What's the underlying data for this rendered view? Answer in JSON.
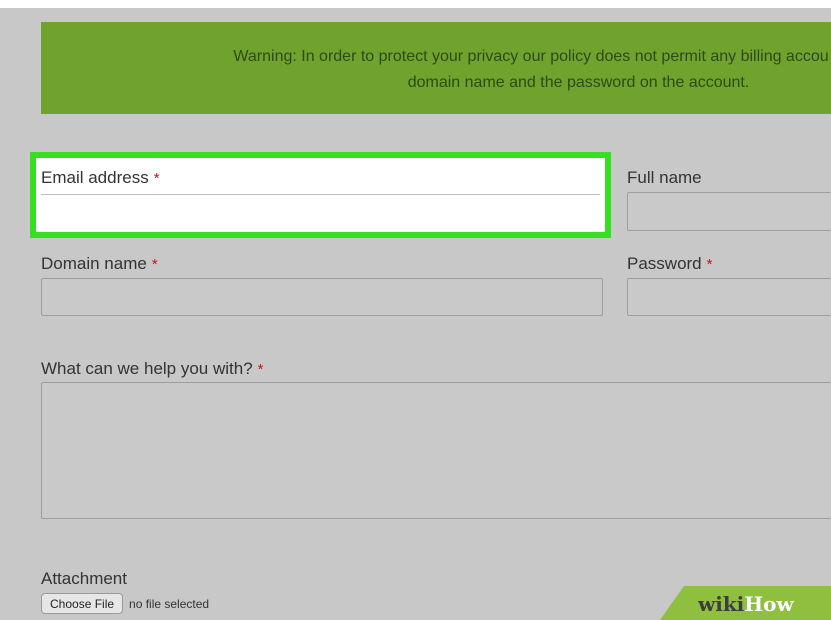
{
  "colors": {
    "banner": "#6fa32e",
    "highlight": "#33e11f",
    "required": "#cc1111",
    "watermark": "#8fbf3f"
  },
  "banner": {
    "line1": "Warning: In order to protect your privacy our policy does not permit any billing accou",
    "line2": "domain name and the password on the account."
  },
  "form": {
    "required_marker": "*",
    "email": {
      "label": "Email address",
      "value": ""
    },
    "full_name": {
      "label": "Full name",
      "value": ""
    },
    "domain": {
      "label": "Domain name",
      "value": ""
    },
    "password": {
      "label": "Password",
      "value": ""
    },
    "help": {
      "label": "What can we help you with?",
      "value": ""
    },
    "attachment": {
      "label": "Attachment",
      "button_label": "Choose File",
      "status": "no file selected"
    }
  },
  "watermark": {
    "part1": "wiki",
    "part2": "How"
  }
}
